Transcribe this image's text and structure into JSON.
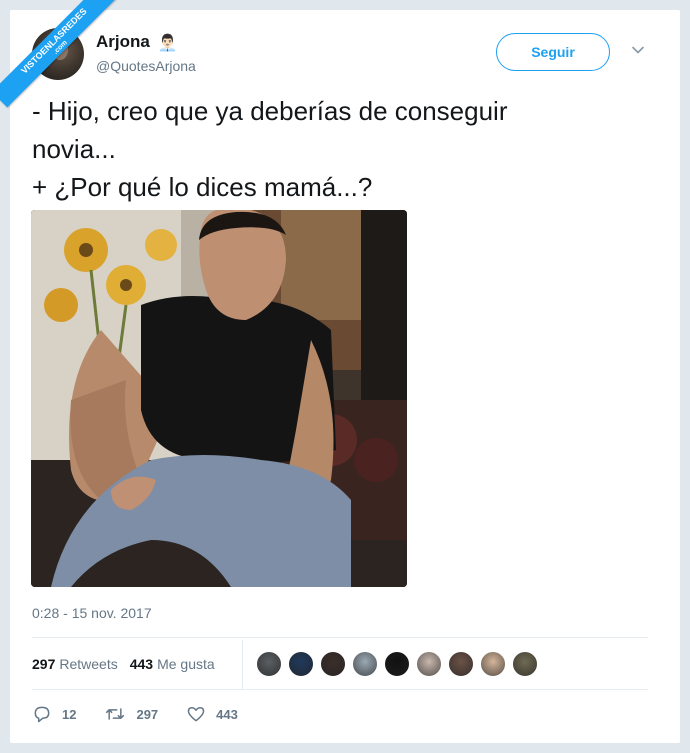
{
  "watermark": {
    "text": "VISTOENLASREDES",
    "suffix": ".com"
  },
  "author": {
    "display_name": "Arjona",
    "handle": "@QuotesArjona",
    "emoji": "👨🏻‍💼"
  },
  "follow_label": "Seguir",
  "tweet": {
    "text": "- Hijo, creo que ya deberías de conseguir\nnovia...\n+ ¿Por qué lo dices mamá...?",
    "timestamp": "0:28 - 15 nov. 2017"
  },
  "stats": {
    "retweets_count": "297",
    "retweets_label": "Retweets",
    "likes_count": "443",
    "likes_label": "Me gusta"
  },
  "liker_avatars": [
    "#5a5f63",
    "#1f3a5c",
    "#3b2e2a",
    "#9aa9b4",
    "#111111",
    "#c9b8ad",
    "#6b5247",
    "#d4b59a",
    "#6f6a52"
  ],
  "actions": {
    "replies": "12",
    "retweets": "297",
    "likes": "443"
  },
  "colors": {
    "accent": "#1da1f2",
    "muted": "#657786",
    "text": "#14171a"
  }
}
